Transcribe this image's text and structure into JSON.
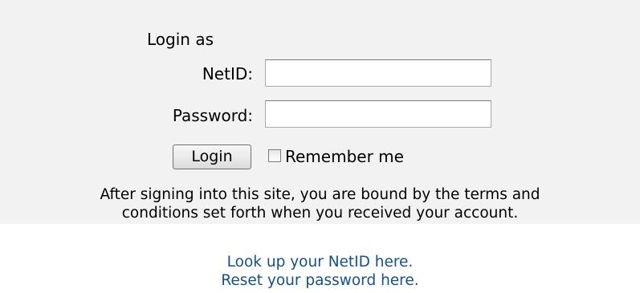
{
  "form": {
    "heading": "Login as",
    "netid_label": "NetID:",
    "netid_value": "",
    "password_label": "Password:",
    "password_value": "",
    "login_button": "Login",
    "remember_label": "Remember me",
    "remember_checked": false,
    "terms_line1": "After signing into this site, you are bound by the terms and",
    "terms_line2": "conditions set forth when you received your account."
  },
  "links": {
    "netid_lookup": "Look up your NetID here.",
    "password_reset": "Reset your password here.",
    "color": "#15508a"
  },
  "colors": {
    "panel_background": "#f2f2f2",
    "page_background": "#ffffff"
  }
}
